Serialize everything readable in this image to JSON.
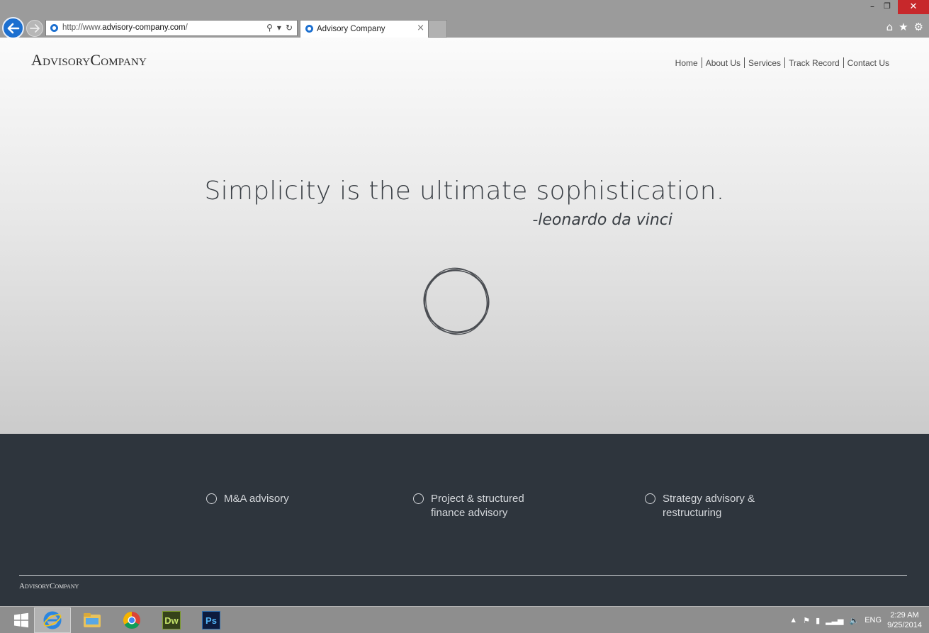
{
  "browser": {
    "url_prefix": "http://www.",
    "url_domain": "advisory-company.com",
    "url_suffix": "/",
    "tab_title": "Advisory Company",
    "search_icon": "search-icon",
    "refresh_icon": "refresh-icon"
  },
  "site": {
    "logo": "AdvisoryCompany",
    "nav": [
      {
        "label": "Home"
      },
      {
        "label": "About Us"
      },
      {
        "label": "Services"
      },
      {
        "label": "Track Record"
      },
      {
        "label": "Contact Us"
      }
    ],
    "quote": "Simplicity is the ultimate sophistication.",
    "author": "-leonardo da vinci",
    "services": [
      {
        "label": "M&A advisory"
      },
      {
        "label": "Project & structured\nfinance advisory"
      },
      {
        "label": "Strategy advisory &\nrestructuring"
      }
    ],
    "footer_logo": "AdvisoryCompany"
  },
  "taskbar": {
    "apps": [
      "Internet Explorer",
      "File Explorer",
      "Chrome",
      "Dw",
      "Ps"
    ],
    "language": "ENG",
    "time": "2:29 AM",
    "date": "9/25/2014"
  },
  "colors": {
    "footer_bg": "#2e353d",
    "ie_blue": "#1b6fd0",
    "close_red": "#c7282b"
  }
}
